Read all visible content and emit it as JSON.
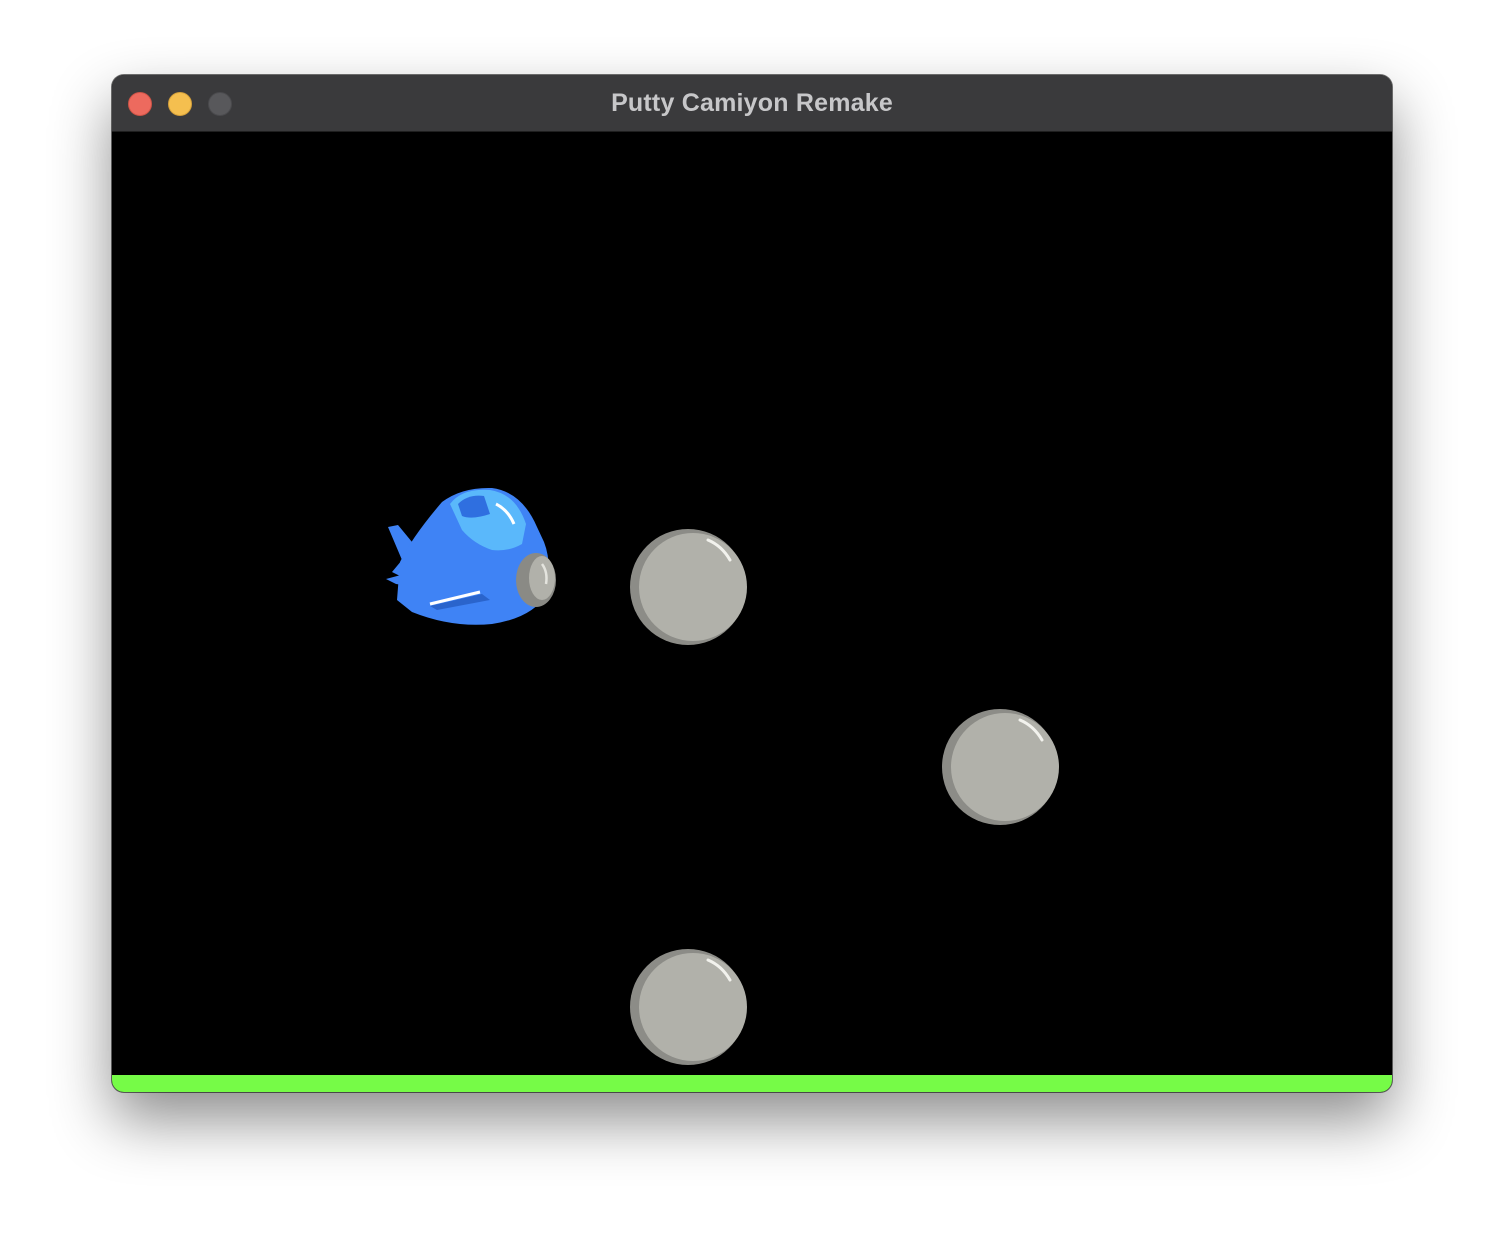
{
  "window": {
    "title": "Putty Camiyon Remake",
    "controls": [
      "close-button",
      "minimize-button",
      "zoom-button"
    ]
  },
  "game": {
    "background_color": "#000000",
    "player": {
      "sprite": "blue-airplane",
      "colors": {
        "body": "#3f83f5",
        "cockpit": "#5ab8fb",
        "propeller": "#8a8a85",
        "highlight": "#ffffff"
      }
    },
    "obstacles": [
      {
        "type": "grey-ball",
        "color": "#b1b1aa"
      },
      {
        "type": "grey-ball",
        "color": "#b1b1aa"
      },
      {
        "type": "grey-ball",
        "color": "#b1b1aa"
      }
    ],
    "ground": {
      "color": "#76fb47"
    }
  }
}
